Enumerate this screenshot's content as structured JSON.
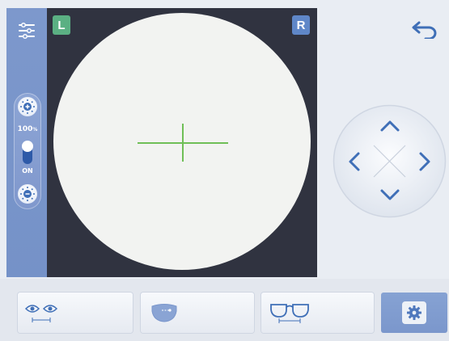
{
  "left_badge": "L",
  "right_badge": "R",
  "brightness": {
    "percent_value": "100",
    "percent_unit": "%",
    "toggle_label": "ON"
  },
  "icons": {
    "settings_sliders": "sliders-icon",
    "brightness_up": "brightness-plus-icon",
    "brightness_down": "brightness-minus-icon",
    "back": "back-arrow-icon",
    "dpad": "direction-pad-icon",
    "pd_measure": "pupil-distance-icon",
    "lens_mode": "lens-icon",
    "frame_mode": "glasses-frame-icon",
    "settings": "gear-icon"
  },
  "colors": {
    "sidebar": "#7d98cc",
    "viewer_bg": "#303340",
    "lens": "#f2f3f1",
    "crosshair": "#6fbf57",
    "badge_left": "#5bb083",
    "badge_right": "#5f87c8",
    "active_button": "#7b97cc",
    "icon_blue": "#3f6fb7"
  }
}
